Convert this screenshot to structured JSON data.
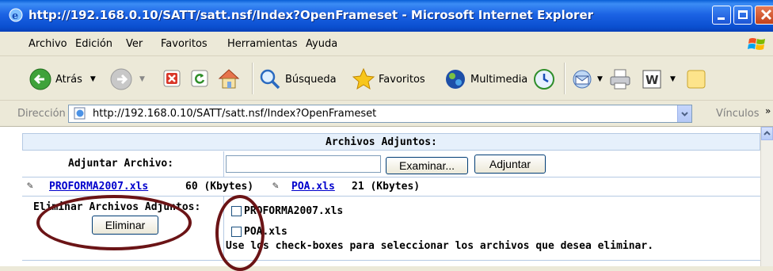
{
  "window": {
    "title": "http://192.168.0.10/SATT/satt.nsf/Index?OpenFrameset - Microsoft Internet Explorer"
  },
  "menu": [
    "Archivo",
    "Edición",
    "Ver",
    "Favoritos",
    "Herramientas",
    "Ayuda"
  ],
  "toolbar": {
    "back_label": "Atrás",
    "search_label": "Búsqueda",
    "favorites_label": "Favoritos",
    "media_label": "Multimedia"
  },
  "address": {
    "label": "Dirección",
    "url": "http://192.168.0.10/SATT/satt.nsf/Index?OpenFrameset",
    "links_label": "Vínculos"
  },
  "form": {
    "section_title": "Archivos Adjuntos:",
    "attach_label": "Adjuntar Archivo:",
    "browse_button": "Examinar...",
    "attach_button": "Adjuntar",
    "files": [
      {
        "name": "PROFORMA2007.xls",
        "size": "60 (Kbytes)"
      },
      {
        "name": "POA.xls",
        "size": "21 (Kbytes)"
      }
    ],
    "delete_label": "Eliminar Archivos Adjuntos:",
    "delete_button": "Eliminar",
    "checkboxes": [
      {
        "label": "PROFORMA2007.xls",
        "checked": false
      },
      {
        "label": "POA.xls",
        "checked": false
      }
    ],
    "help_text": "Use los check-boxes para seleccionar los archivos que desea eliminar."
  },
  "colors": {
    "annotation_ellipse": "#6b1416",
    "link": "#0000cc",
    "section_header_bg": "#e6f0fb"
  }
}
